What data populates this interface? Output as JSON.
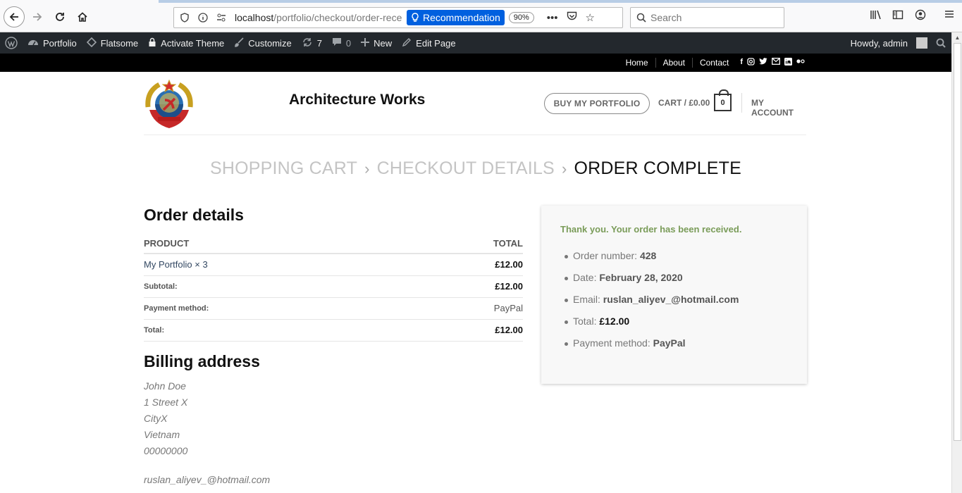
{
  "browser": {
    "url_host": "localhost",
    "url_path": "/portfolio/checkout/order-rece",
    "recommendation_label": "Recommendation",
    "zoom": "90%",
    "search_placeholder": "Search"
  },
  "adminbar": {
    "items": [
      "Portfolio",
      "Flatsome",
      "Activate Theme",
      "Customize",
      "7",
      "0",
      "New",
      "Edit Page"
    ],
    "greeting": "Howdy, admin"
  },
  "topbar": {
    "links": [
      "Home",
      "About",
      "Contact"
    ]
  },
  "header": {
    "site_title": "Architecture Works",
    "buy_button": "BUY MY PORTFOLIO",
    "cart_label": "CART / £0.00",
    "cart_count": "0",
    "account_label": "MY ACCOUNT"
  },
  "steps": {
    "step1": "SHOPPING CART",
    "step2": "CHECKOUT DETAILS",
    "step3": "ORDER COMPLETE",
    "separator": "›"
  },
  "order_details": {
    "heading": "Order details",
    "col_product": "PRODUCT",
    "col_total": "TOTAL",
    "product_name": "My Portfolio",
    "product_qty": "× 3",
    "product_total": "£12.00",
    "subtotal_label": "Subtotal:",
    "subtotal_value": "£12.00",
    "payment_label": "Payment method:",
    "payment_value": "PayPal",
    "total_label": "Total:",
    "total_value": "£12.00"
  },
  "billing": {
    "heading": "Billing address",
    "name": "John Doe",
    "street": "1 Street X",
    "city": "CityX",
    "country": "Vietnam",
    "phone": "00000000",
    "email": "ruslan_aliyev_@hotmail.com"
  },
  "thankyou": {
    "message": "Thank you. Your order has been received.",
    "order_number_label": "Order number:",
    "order_number": "428",
    "date_label": "Date:",
    "date": "February 28, 2020",
    "email_label": "Email:",
    "email": "ruslan_aliyev_@hotmail.com",
    "total_label": "Total:",
    "total": "£12.00",
    "payment_label": "Payment method:",
    "payment": "PayPal"
  },
  "colors": {
    "adminbar_bg": "#23282d",
    "topbar_bg": "#000000",
    "success_green": "#7a9c59",
    "link_blue": "#334862",
    "recommendation_blue": "#0060df"
  }
}
